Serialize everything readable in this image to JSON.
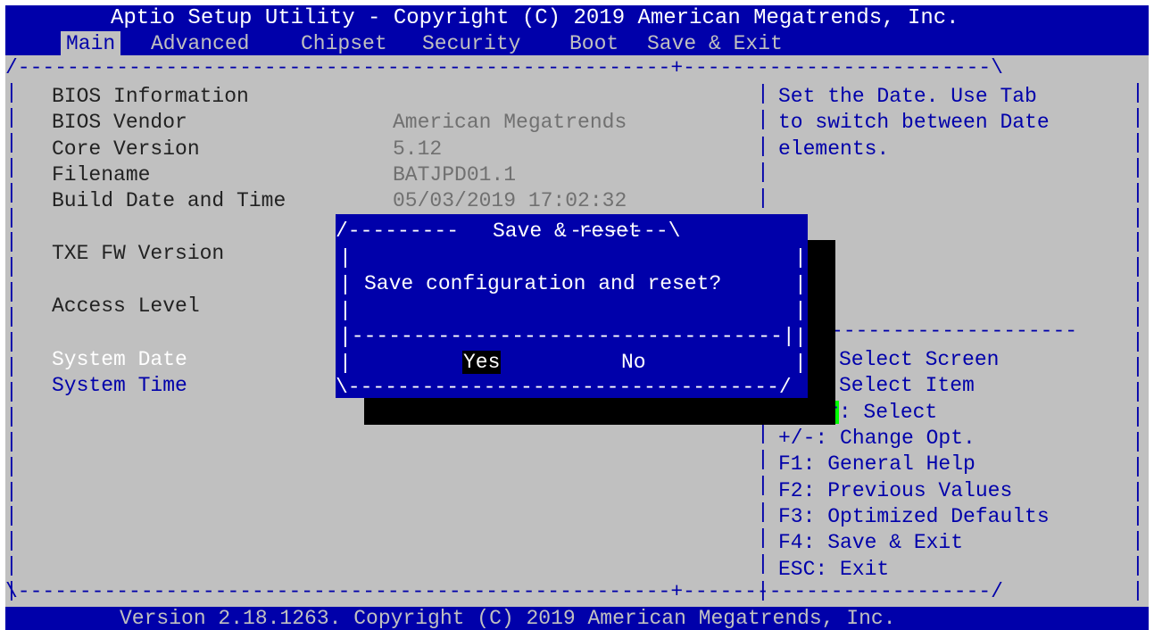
{
  "app": {
    "title": "Aptio Setup Utility - Copyright (C) 2019 American Megatrends, Inc.",
    "footer": "Version 2.18.1263. Copyright (C) 2019 American Megatrends, Inc."
  },
  "menu": {
    "tabs": [
      "Main",
      "Advanced",
      "Chipset",
      "Security",
      "Boot",
      "Save & Exit"
    ],
    "active": "Main"
  },
  "main": {
    "section_heading": "BIOS Information",
    "rows": [
      {
        "label": "BIOS Vendor",
        "value": "American Megatrends"
      },
      {
        "label": "Core Version",
        "value": "5.12"
      },
      {
        "label": "Filename",
        "value": "BATJPD01.1"
      },
      {
        "label": "Build Date and Time",
        "value": "05/03/2019 17:02:32"
      }
    ],
    "txe_label": "TXE FW Version",
    "access_label": "Access Level",
    "system_date_label": "System Date",
    "system_time_label": "System Time"
  },
  "help": {
    "description": [
      "Set the Date. Use Tab",
      "to switch between Date",
      "elements."
    ],
    "keys": [
      "Select Screen",
      "Select Item",
      "r: Select",
      "+/-: Change Opt.",
      "F1: General Help",
      "F2: Previous Values",
      "F3: Optimized Defaults",
      "F4: Save & Exit",
      "ESC: Exit"
    ]
  },
  "dialog": {
    "title": "Save & reset",
    "message": "Save configuration and reset?",
    "yes_label": "Yes",
    "no_label": "No"
  },
  "colors": {
    "background": "#c0c0c0",
    "header": "#0000aa",
    "highlight": "#00ff00"
  }
}
